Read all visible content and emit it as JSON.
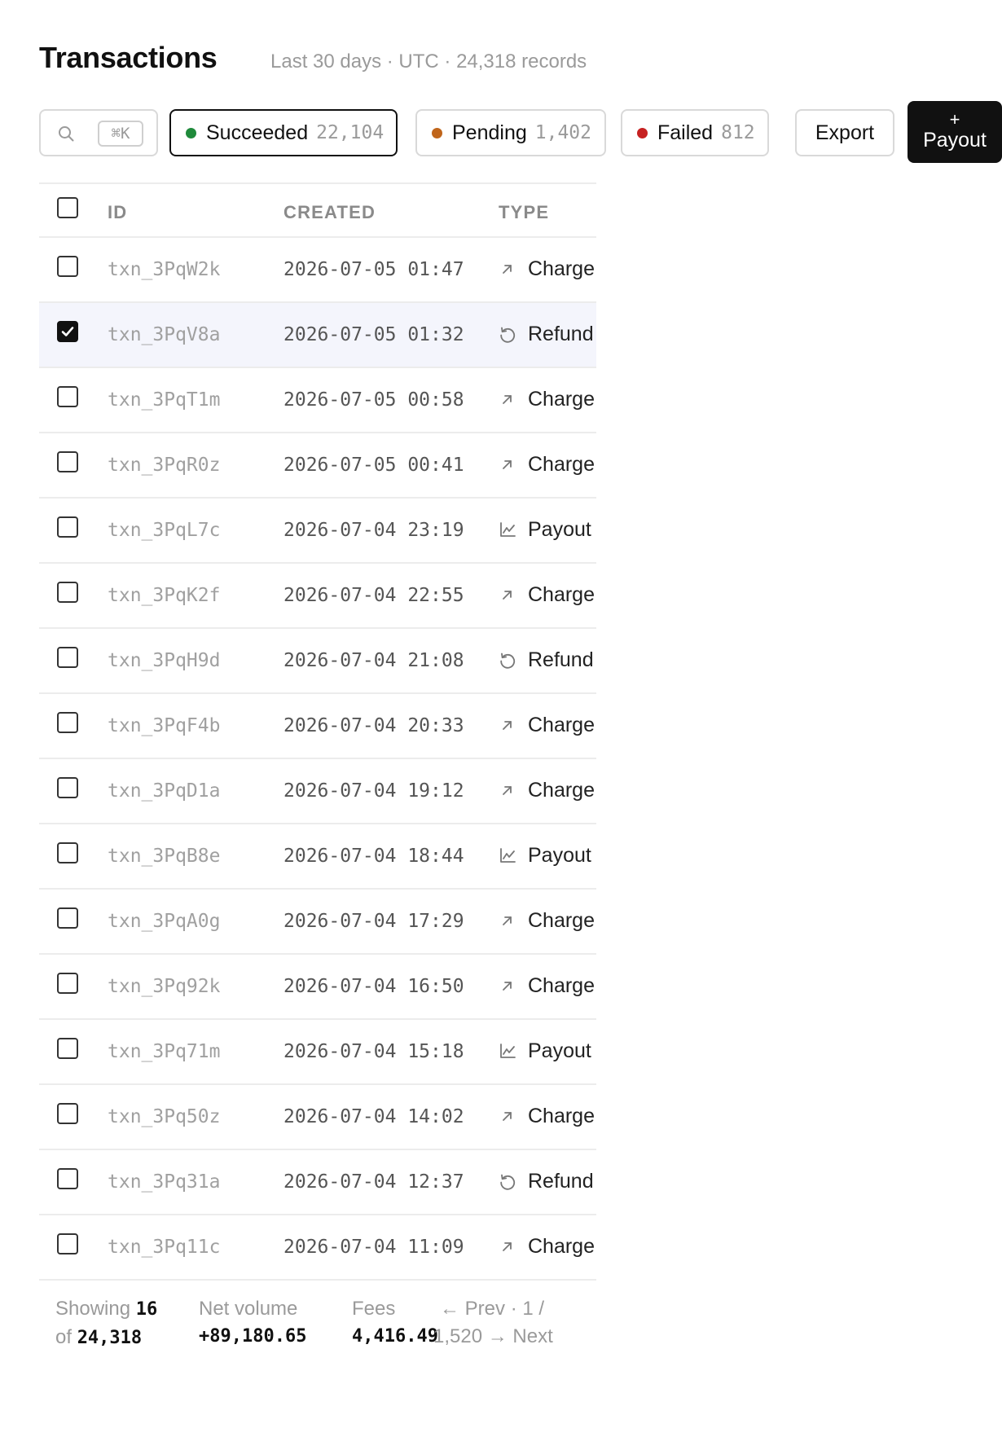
{
  "header": {
    "title": "Transactions",
    "subtitle": "Last 30 days · UTC · 24,318 records"
  },
  "toolbar": {
    "search_shortcut": "⌘K",
    "filters": [
      {
        "label": "Succeeded",
        "count": "22,104",
        "color": "#1f8a3b",
        "active": true
      },
      {
        "label": "Pending",
        "count": "1,402",
        "color": "#c0651a",
        "active": false
      },
      {
        "label": "Failed",
        "count": "812",
        "color": "#c62121",
        "active": false
      }
    ],
    "export_label": "Export",
    "payout_plus": "+",
    "payout_label": "Payout"
  },
  "table": {
    "columns": {
      "id": "ID",
      "created": "CREATED",
      "type": "TYPE"
    },
    "rows": [
      {
        "id": "txn_3PqW2k",
        "created": "2026-07-05 01:47",
        "type": "Charge",
        "icon": "arrow-up-right-icon",
        "selected": false
      },
      {
        "id": "txn_3PqV8a",
        "created": "2026-07-05 01:32",
        "type": "Refund",
        "icon": "refund-icon",
        "selected": true
      },
      {
        "id": "txn_3PqT1m",
        "created": "2026-07-05 00:58",
        "type": "Charge",
        "icon": "arrow-up-right-icon",
        "selected": false
      },
      {
        "id": "txn_3PqR0z",
        "created": "2026-07-05 00:41",
        "type": "Charge",
        "icon": "arrow-up-right-icon",
        "selected": false
      },
      {
        "id": "txn_3PqL7c",
        "created": "2026-07-04 23:19",
        "type": "Payout",
        "icon": "chart-line-icon",
        "selected": false
      },
      {
        "id": "txn_3PqK2f",
        "created": "2026-07-04 22:55",
        "type": "Charge",
        "icon": "arrow-up-right-icon",
        "selected": false
      },
      {
        "id": "txn_3PqH9d",
        "created": "2026-07-04 21:08",
        "type": "Refund",
        "icon": "refund-icon",
        "selected": false
      },
      {
        "id": "txn_3PqF4b",
        "created": "2026-07-04 20:33",
        "type": "Charge",
        "icon": "arrow-up-right-icon",
        "selected": false
      },
      {
        "id": "txn_3PqD1a",
        "created": "2026-07-04 19:12",
        "type": "Charge",
        "icon": "arrow-up-right-icon",
        "selected": false
      },
      {
        "id": "txn_3PqB8e",
        "created": "2026-07-04 18:44",
        "type": "Payout",
        "icon": "chart-line-icon",
        "selected": false
      },
      {
        "id": "txn_3PqA0g",
        "created": "2026-07-04 17:29",
        "type": "Charge",
        "icon": "arrow-up-right-icon",
        "selected": false
      },
      {
        "id": "txn_3Pq92k",
        "created": "2026-07-04 16:50",
        "type": "Charge",
        "icon": "arrow-up-right-icon",
        "selected": false
      },
      {
        "id": "txn_3Pq71m",
        "created": "2026-07-04 15:18",
        "type": "Payout",
        "icon": "chart-line-icon",
        "selected": false
      },
      {
        "id": "txn_3Pq50z",
        "created": "2026-07-04 14:02",
        "type": "Charge",
        "icon": "arrow-up-right-icon",
        "selected": false
      },
      {
        "id": "txn_3Pq31a",
        "created": "2026-07-04 12:37",
        "type": "Refund",
        "icon": "refund-icon",
        "selected": false
      },
      {
        "id": "txn_3Pq11c",
        "created": "2026-07-04 11:09",
        "type": "Charge",
        "icon": "arrow-up-right-icon",
        "selected": false
      }
    ]
  },
  "footer": {
    "showing_label": "Showing",
    "showing_count": "16",
    "of_label": "of",
    "total": "24,318",
    "net_volume_label": "Net volume",
    "net_volume": "+89,180.65",
    "fees_label": "Fees",
    "fees": "4,416.49",
    "prev_label": "← Prev",
    "page_sep": "·",
    "page_current": "1",
    "page_slash": "/",
    "page_total": "1,520",
    "next_label": "→ Next"
  }
}
